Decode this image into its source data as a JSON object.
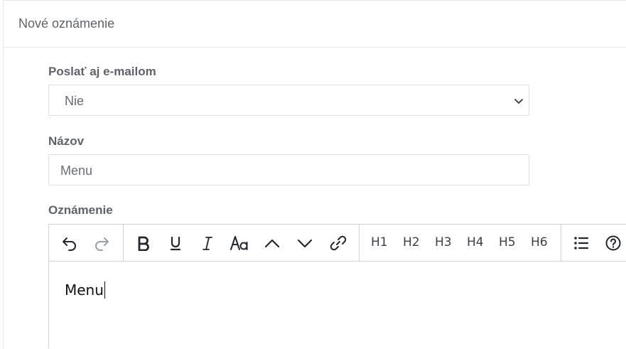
{
  "card": {
    "title": "Nové oznámenie"
  },
  "form": {
    "email_label": "Poslať aj e-mailom",
    "email_value": "Nie",
    "name_label": "Názov",
    "name_value": "Menu",
    "announcement_label": "Oznámenie"
  },
  "editor": {
    "toolbar": {
      "headings": [
        "H1",
        "H2",
        "H3",
        "H4",
        "H5",
        "H6"
      ],
      "icons": [
        "undo-icon",
        "redo-icon",
        "bold-icon",
        "underline-icon",
        "italic-icon",
        "font-size-icon",
        "caret-up-icon",
        "caret-down-icon",
        "link-icon",
        "bullet-list-icon",
        "help-icon"
      ]
    },
    "content": "Menu"
  }
}
